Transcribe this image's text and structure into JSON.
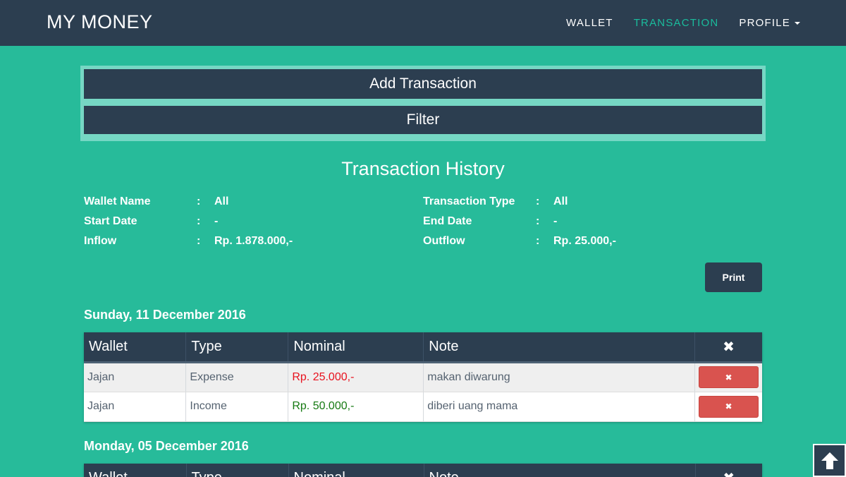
{
  "navbar": {
    "brand": "MY MONEY",
    "links": [
      {
        "label": "WALLET",
        "active": false
      },
      {
        "label": "TRANSACTION",
        "active": true
      },
      {
        "label": "PROFILE",
        "active": false
      }
    ]
  },
  "actions": {
    "add_label": "Add Transaction",
    "filter_label": "Filter"
  },
  "page_title": "Transaction History",
  "summary": {
    "left": [
      {
        "label": "Wallet Name",
        "colon": ":",
        "value": "All"
      },
      {
        "label": "Start Date",
        "colon": ":",
        "value": "-"
      },
      {
        "label": "Inflow",
        "colon": ":",
        "value": "Rp. 1.878.000,-"
      }
    ],
    "right": [
      {
        "label": "Transaction Type",
        "colon": ":",
        "value": "All"
      },
      {
        "label": "End Date",
        "colon": ":",
        "value": "-"
      },
      {
        "label": "Outflow",
        "colon": ":",
        "value": "Rp. 25.000,-"
      }
    ]
  },
  "print_label": "Print",
  "table_headers": {
    "wallet": "Wallet",
    "type": "Type",
    "nominal": "Nominal",
    "note": "Note",
    "delete": "✖"
  },
  "groups": [
    {
      "date": "Sunday, 11 December 2016",
      "rows": [
        {
          "wallet": "Jajan",
          "type": "Expense",
          "nominal": "Rp. 25.000,-",
          "note": "makan diwarung",
          "delete": "✖"
        },
        {
          "wallet": "Jajan",
          "type": "Income",
          "nominal": "Rp. 50.000,-",
          "note": "diberi uang mama",
          "delete": "✖"
        }
      ]
    },
    {
      "date": "Monday, 05 December 2016",
      "rows": []
    }
  ],
  "colors": {
    "background": "#27bb9a",
    "navbar": "#2c3e50",
    "active_link": "#1abc9c",
    "expense": "#e8121e",
    "income": "#167a13",
    "delete_button": "#d9534f"
  },
  "icons": {
    "delete": "close-icon",
    "scroll_top": "arrow-up-icon",
    "profile_dropdown": "caret-down-icon"
  }
}
